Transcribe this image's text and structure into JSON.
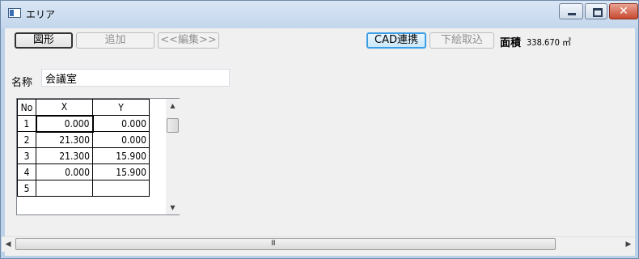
{
  "window": {
    "title": "エリア",
    "controls": {
      "minimize": "",
      "maximize": "",
      "close": "✕"
    }
  },
  "toolbar": {
    "shape_button": "図形",
    "add_button": "追加",
    "edit_button": "<<編集>>",
    "cad_button": "CAD連携",
    "import_button": "下絵取込",
    "area_label": "面積",
    "area_value": "338.670 ㎡"
  },
  "name_field": {
    "label": "名称",
    "value": "会議室"
  },
  "grid": {
    "headers": [
      "No",
      "X",
      "Y"
    ],
    "rows": [
      {
        "no": "1",
        "x": "0.000",
        "y": "0.000"
      },
      {
        "no": "2",
        "x": "21.300",
        "y": "0.000"
      },
      {
        "no": "3",
        "x": "21.300",
        "y": "15.900"
      },
      {
        "no": "4",
        "x": "0.000",
        "y": "15.900"
      },
      {
        "no": "5",
        "x": "",
        "y": ""
      }
    ],
    "up_arrow": "▲",
    "down_arrow": "▼"
  },
  "hscroll": {
    "grip": "III",
    "left_arrow": "◀",
    "right_arrow": "▶"
  },
  "colors": {
    "titlebar": "#c4d6ec",
    "client": "#f0f0f0",
    "cad_accent": "#3c9ee5"
  }
}
